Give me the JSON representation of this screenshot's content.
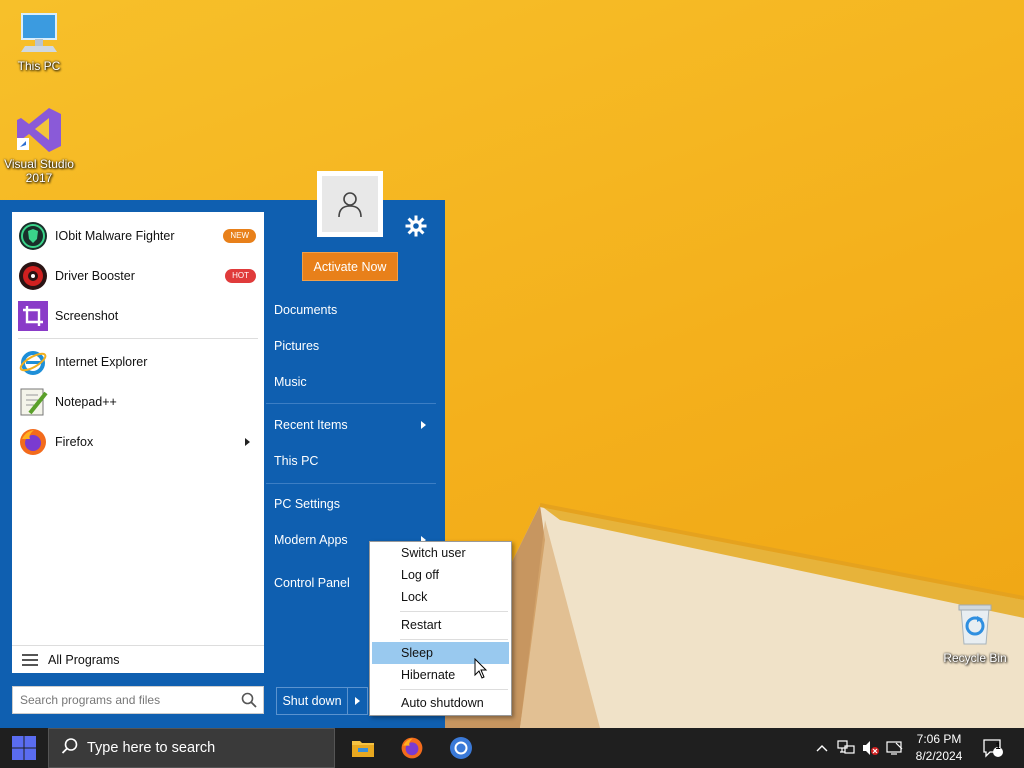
{
  "desktop": {
    "icons": [
      {
        "label": "This PC"
      },
      {
        "label": "Visual Studio 2017"
      },
      {
        "label": "Recycle Bin"
      }
    ]
  },
  "start_menu": {
    "programs": [
      {
        "label": "IObit Malware Fighter",
        "badge": "NEW",
        "badge_color": "#e8801a"
      },
      {
        "label": "Driver Booster",
        "badge": "HOT",
        "badge_color": "#e03b3b"
      },
      {
        "label": "Screenshot"
      },
      {
        "label": "Internet Explorer"
      },
      {
        "label": "Notepad++"
      },
      {
        "label": "Firefox"
      }
    ],
    "all_programs": "All Programs",
    "search_placeholder": "Search programs and files",
    "activate": "Activate Now",
    "right_items": {
      "documents": "Documents",
      "pictures": "Pictures",
      "music": "Music",
      "recent": "Recent Items",
      "this_pc": "This PC",
      "pc_settings": "PC Settings",
      "modern_apps": "Modern Apps",
      "control_panel": "Control Panel"
    },
    "shutdown": "Shut down"
  },
  "power_menu": {
    "items": [
      "Switch user",
      "Log off",
      "Lock",
      "Restart",
      "Sleep",
      "Hibernate",
      "Auto shutdown"
    ],
    "highlighted": "Sleep"
  },
  "taskbar": {
    "search_placeholder": "Type here to search",
    "time": "7:06 PM",
    "date": "8/2/2024",
    "notification_count": "1"
  },
  "colors": {
    "start_blue": "#0f5fb0",
    "activate_orange": "#e8801a",
    "highlight": "#99c9ef",
    "taskbar": "#1f1f1f"
  }
}
